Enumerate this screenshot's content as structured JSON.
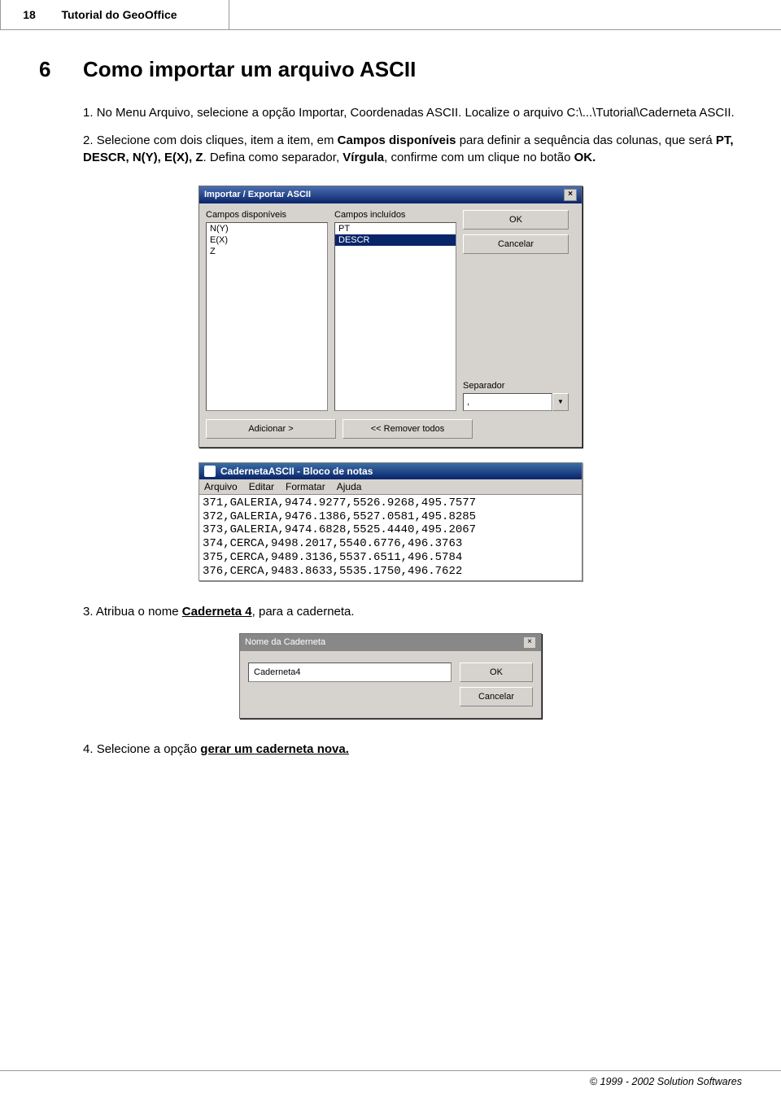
{
  "header": {
    "page_num": "18",
    "doc_title": "Tutorial do GeoOffice"
  },
  "section": {
    "num": "6",
    "title": "Como importar um arquivo ASCII"
  },
  "step1": {
    "n": "1.",
    "text1": "No Menu Arquivo, selecione a opção Importar, Coordenadas ASCII. Localize o arquivo C:\\...\\Tutorial\\Caderneta ASCII."
  },
  "step2": {
    "n": "2.",
    "pre": "Selecione com dois cliques, item a item, em ",
    "b1": "Campos disponíveis",
    "mid1": " para definir a sequência das colunas, que será ",
    "b2": "PT, DESCR, N(Y), E(X), Z",
    "mid2": ". Defina como separador, ",
    "b3": "Vírgula",
    "mid3": ", confirme com um clique no botão ",
    "b4": "OK."
  },
  "dialog1": {
    "title": "Importar / Exportar ASCII",
    "close_glyph": "×",
    "left_label": "Campos disponíveis",
    "left_items": [
      "N(Y)",
      "E(X)",
      "Z"
    ],
    "right_label": "Campos incluídos",
    "right_items": [
      "PT",
      "DESCR"
    ],
    "right_selected_index": 1,
    "ok": "OK",
    "cancel": "Cancelar",
    "sep_label": "Separador",
    "sep_value": ",",
    "btn_add": "Adicionar >",
    "btn_remove": "<< Remover todos"
  },
  "notepad": {
    "title": "CadernetaASCII - Bloco de notas",
    "menu": [
      "Arquivo",
      "Editar",
      "Formatar",
      "Ajuda"
    ],
    "lines": [
      "371,GALERIA,9474.9277,5526.9268,495.7577",
      "372,GALERIA,9476.1386,5527.0581,495.8285",
      "373,GALERIA,9474.6828,5525.4440,495.2067",
      "374,CERCA,9498.2017,5540.6776,496.3763",
      "375,CERCA,9489.3136,5537.6511,496.5784",
      "376,CERCA,9483.8633,5535.1750,496.7622"
    ]
  },
  "step3": {
    "n": "3.",
    "pre": "Atribua o nome ",
    "b": "Caderneta 4",
    "post": ", para a caderneta."
  },
  "dialog2": {
    "title": "Nome da Caderneta",
    "close_glyph": "×",
    "value": "Caderneta4",
    "ok": "OK",
    "cancel": "Cancelar"
  },
  "step4": {
    "n": "4.",
    "pre": "Selecione a opção ",
    "b": "gerar um caderneta nova."
  },
  "footer": "© 1999 - 2002 Solution Softwares"
}
